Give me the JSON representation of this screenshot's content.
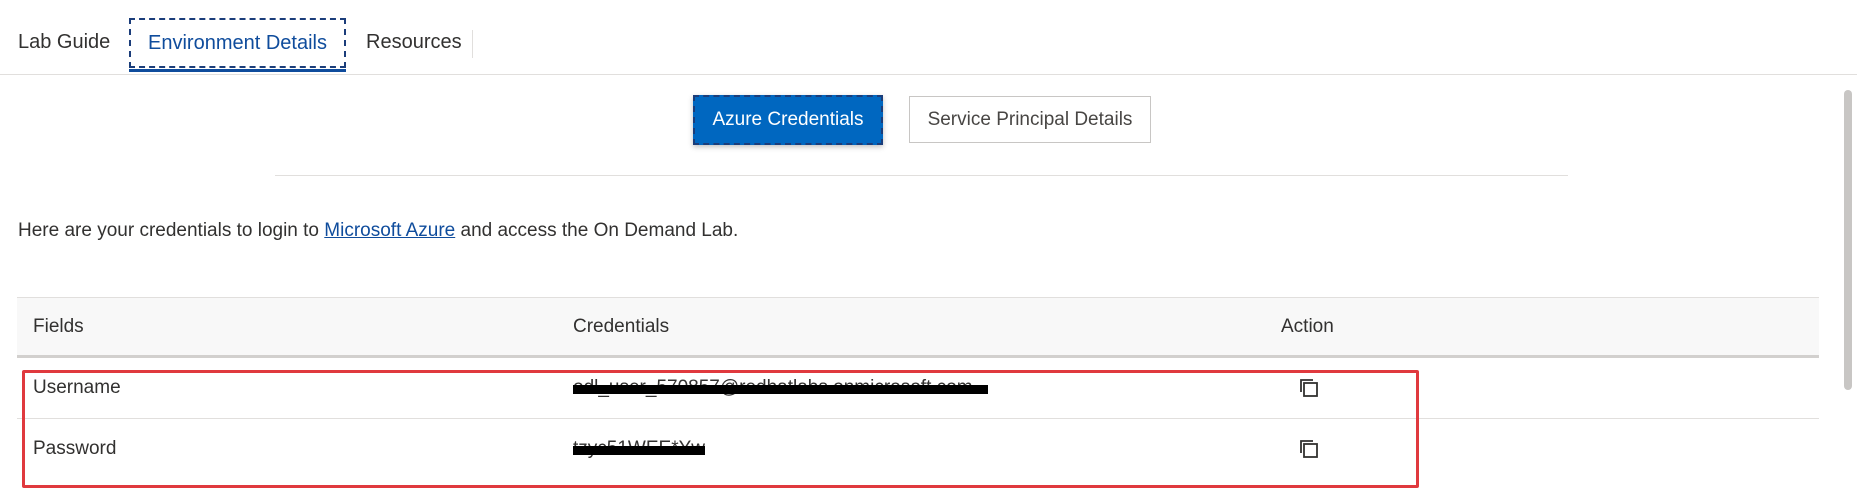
{
  "tabs": [
    {
      "label": "Lab Guide"
    },
    {
      "label": "Environment Details",
      "active": true
    },
    {
      "label": "Resources"
    }
  ],
  "subtabs": {
    "primary_label": "Azure Credentials",
    "secondary_label": "Service Principal Details"
  },
  "intro": {
    "prefix": "Here are your credentials to login to ",
    "link_text": "Microsoft Azure",
    "suffix": " and access the On Demand Lab."
  },
  "table": {
    "headers": {
      "fields": "Fields",
      "credentials": "Credentials",
      "action": "Action"
    },
    "rows": [
      {
        "field": "Username",
        "credential": "odl_user_570857@redhatlabs.onmicrosoft.com",
        "action_icon": "copy-icon"
      },
      {
        "field": "Password",
        "credential": "tzyc51WEE*Yw",
        "action_icon": "copy-icon"
      }
    ]
  },
  "colors": {
    "accent": "#0067c0",
    "link": "#0f4c9c",
    "highlight": "#e0393e"
  }
}
